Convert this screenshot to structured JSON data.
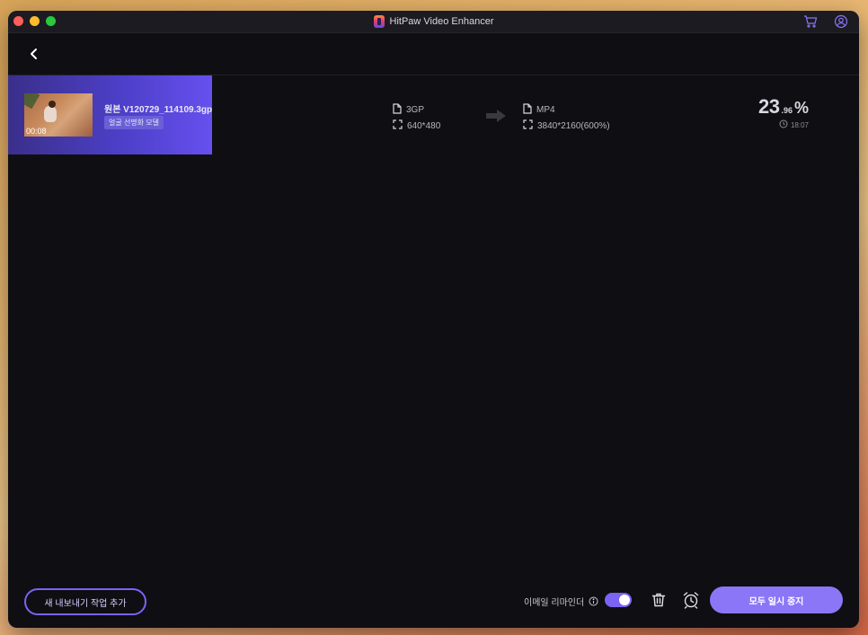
{
  "window": {
    "title": "HitPaw Video Enhancer"
  },
  "task": {
    "file_name": "원본 V120729_114109.3gp",
    "duration": "00:08",
    "model": "얼굴 선명화 모델",
    "source": {
      "format": "3GP",
      "resolution": "640*480"
    },
    "output": {
      "format": "MP4",
      "resolution": "3840*2160(600%)"
    },
    "progress": {
      "percent_main": "23",
      "percent_frac": ".96",
      "percent_sign": "%",
      "value": 23.96,
      "eta": "18:07"
    }
  },
  "footer": {
    "add_task_label": "새 내보내기 작업 추가",
    "email_reminder_label": "이메일 리마인더",
    "email_reminder_on": true,
    "pause_all_label": "모두 일시 중지"
  },
  "colors": {
    "accent": "#7b63f5",
    "button": "#8c76f8",
    "background": "#0f0e13"
  },
  "icons": [
    "cart-icon",
    "account-icon",
    "back-icon",
    "file-icon",
    "resolution-icon",
    "arrow-right-icon",
    "clock-icon",
    "info-icon",
    "trash-icon",
    "alarm-icon"
  ]
}
